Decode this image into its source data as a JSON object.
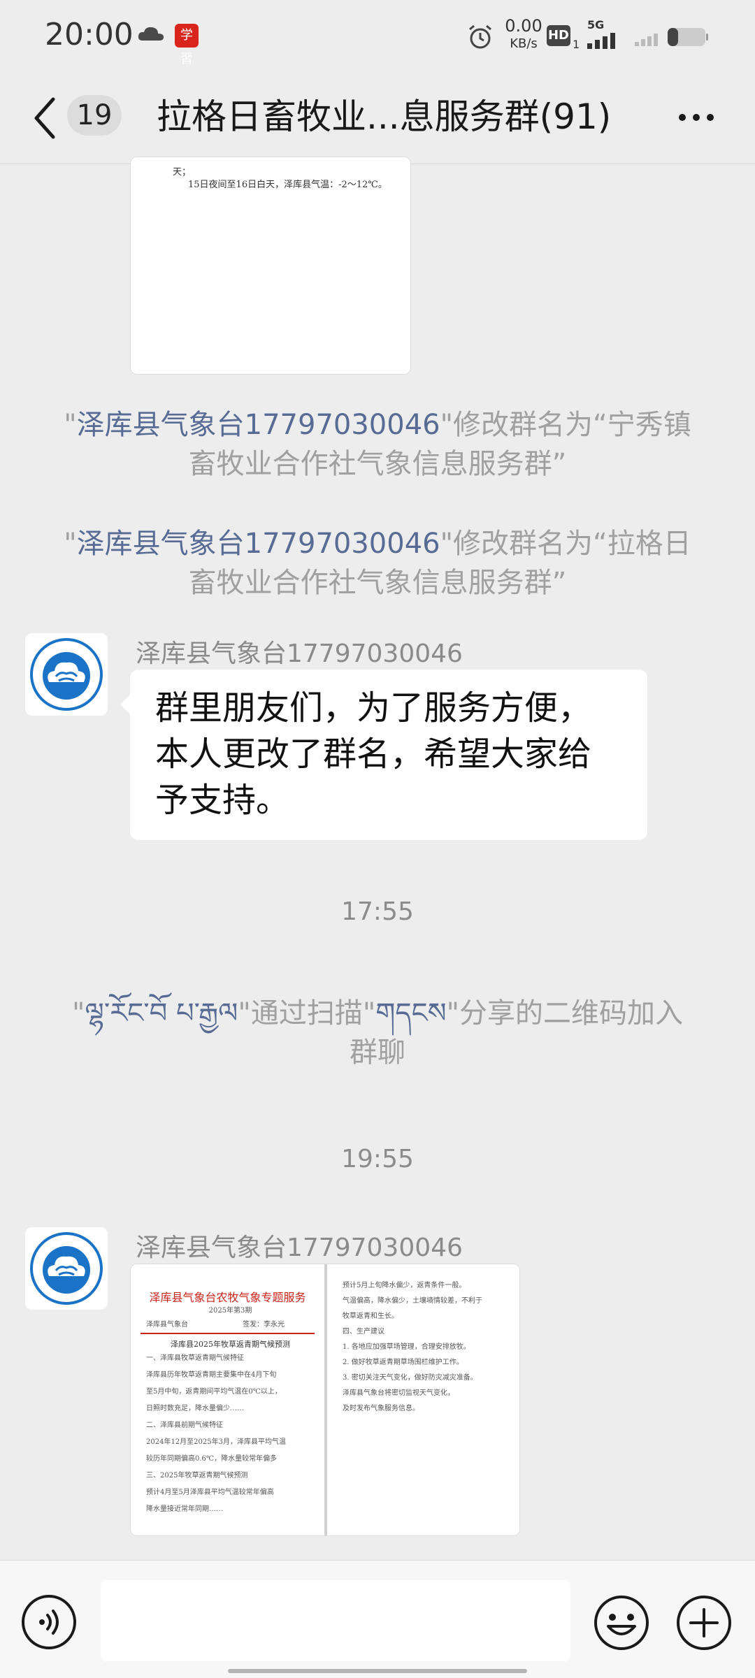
{
  "status_bar": {
    "time": "20:00",
    "red_app_icon_text": "学習",
    "net_speed_value": "0.00",
    "net_speed_unit": "KB/s",
    "hd_label": "HD",
    "hd_sub": "1",
    "network_label": "5G",
    "icons": [
      "cloud-icon",
      "alarm-icon",
      "hd-icon",
      "signal-icon",
      "battery-icon"
    ]
  },
  "header": {
    "unread_count": "19",
    "title": "拉格日畜牧业...息服务群(91)"
  },
  "messages": {
    "top_doc": {
      "line1": "天；",
      "line2": "15日夜间至16日白天，泽库县气温：-2～12℃。"
    },
    "notice1": {
      "q1": "\"",
      "who": "泽库县气象台17797030046",
      "rest": "\"修改群名为“宁秀镇畜牧业合作社气象信息服务群”"
    },
    "notice2": {
      "q1": "\"",
      "who": "泽库县气象台17797030046",
      "rest": "\"修改群名为“拉格日畜牧业合作社气象信息服务群”"
    },
    "msg1": {
      "sender": "泽库县气象台17797030046",
      "text": "群里朋友们，为了服务方便，本人更改了群名，希望大家给予支持。"
    },
    "time1": "17:55",
    "notice3": {
      "q1": "\"",
      "who": "ལྷ་རོང་བོ  པ་རྒྱལ",
      "mid": "\"通过扫描\"",
      "via": "གདངས",
      "rest": "\"分享的二维码加入群聊"
    },
    "time2": "19:55",
    "msg2": {
      "sender": "泽库县气象台17797030046",
      "doc_title": "泽库县气象台农牧气象专题服务",
      "doc_subtitle": "2025年第3期",
      "doc_meta_left": "泽库县气象台",
      "doc_meta_right": "签发：李永光",
      "doc_heading": "泽库县2025年牧草返青期气候预测",
      "left_lines": [
        "一、泽库县牧草返青期气候特征",
        "泽库县历年牧草返青期主要集中在4月下旬",
        "至5月中旬，返青期间平均气温在0℃以上，",
        "日照时数充足，降水量偏少……",
        "二、泽库县前期气候特征",
        "2024年12月至2025年3月，泽库县平均气温",
        "较历年同期偏高0.6℃，降水量较常年偏多",
        "三、2025年牧草返青期气候预测",
        "预计4月至5月泽库县平均气温较常年偏高",
        "降水量接近常年同期……"
      ],
      "right_lines": [
        "预计5月上旬降水偏少，返青条件一般。",
        "气温偏高，降水偏少，土壤墒情较差，不利于",
        "牧草返青和生长。",
        "四、生产建议",
        "1. 各地应加强草场管理，合理安排放牧。",
        "2. 做好牧草返青期草场围栏维护工作。",
        "3. 密切关注天气变化，做好防灾减灾准备。",
        "泽库县气象台将密切监视天气变化，",
        "及时发布气象服务信息。"
      ]
    }
  },
  "input_bar": {
    "placeholder": ""
  }
}
